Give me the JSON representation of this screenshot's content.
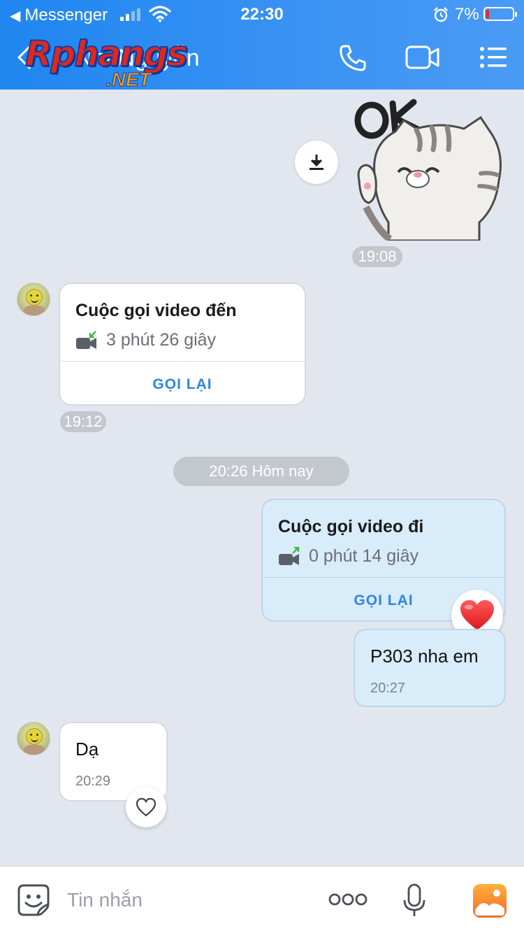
{
  "status_bar": {
    "back_app": "Messenger",
    "time": "22:30",
    "battery_pct": "7%"
  },
  "header": {
    "title": "Nhi Nguyễn",
    "watermark_line1": "Rphangs",
    "watermark_line2": ".NET"
  },
  "messages": {
    "sticker_time": "19:08",
    "incoming_call": {
      "title": "Cuộc gọi video đến",
      "duration": "3 phút 26 giây",
      "callback": "GỌI LẠI",
      "time": "19:12"
    },
    "date_divider": "20:26 Hôm nay",
    "outgoing_call": {
      "title": "Cuộc gọi video đi",
      "duration": "0 phút 14 giây",
      "callback": "GỌI LẠI"
    },
    "out_text": {
      "text": "P303 nha em",
      "time": "20:27"
    },
    "in_text": {
      "text": "Dạ",
      "time": "20:29"
    }
  },
  "input": {
    "placeholder": "Tin nhắn"
  },
  "colors": {
    "header_blue": "#1f86f0",
    "accent_blue": "#2f86e6",
    "outgoing_bubble": "#d9ecfa",
    "heart_red": "#e8262b"
  }
}
